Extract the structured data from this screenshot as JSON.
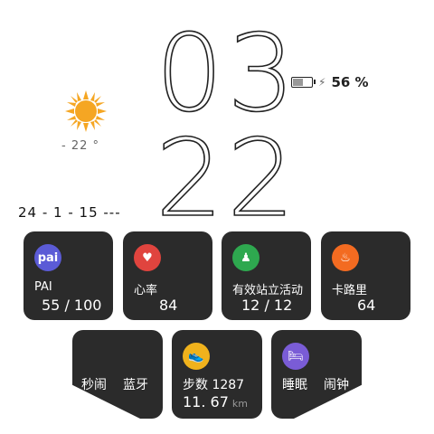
{
  "clock": {
    "hour": "03",
    "minute": "22"
  },
  "weather": {
    "icon": "sun-icon",
    "temperature": "- 22 °"
  },
  "battery": {
    "percent": "56",
    "percent_suffix": "%",
    "level": 0.56,
    "charging_icon": "charging-icon"
  },
  "date": {
    "text": "24 - 1 - 15 ---"
  },
  "cards": [
    {
      "icon": "pai-icon",
      "icon_text": "pai",
      "icon_color": "#5b5bd6",
      "label": "PAI",
      "value": "55 / 100"
    },
    {
      "icon": "heart-icon",
      "icon_text": "♥",
      "icon_color": "#e0443e",
      "label": "心率",
      "value": "84"
    },
    {
      "icon": "standing-person-icon",
      "icon_text": "♟",
      "icon_color": "#2ea84f",
      "label": "有效站立活动",
      "value": "12 / 12"
    },
    {
      "icon": "flame-icon",
      "icon_text": "♨",
      "icon_color": "#f36b21",
      "label": "卡路里",
      "value": "64"
    }
  ],
  "bottom": {
    "left": {
      "label_a": "秒闹",
      "label_b": "蓝牙"
    },
    "center": {
      "icon": "shoe-icon",
      "icon_text": "👟",
      "icon_color": "#f0b21c",
      "label": "步数",
      "steps": "1287",
      "distance": "11. 67",
      "distance_unit": "km"
    },
    "right": {
      "icon": "bed-icon",
      "icon_text": "🛏",
      "icon_color": "#7a5cd6",
      "label_a": "睡眠",
      "label_b": "闹钟"
    }
  },
  "colors": {
    "card_bg": "#2b2b2b",
    "background": "#ffffff"
  }
}
